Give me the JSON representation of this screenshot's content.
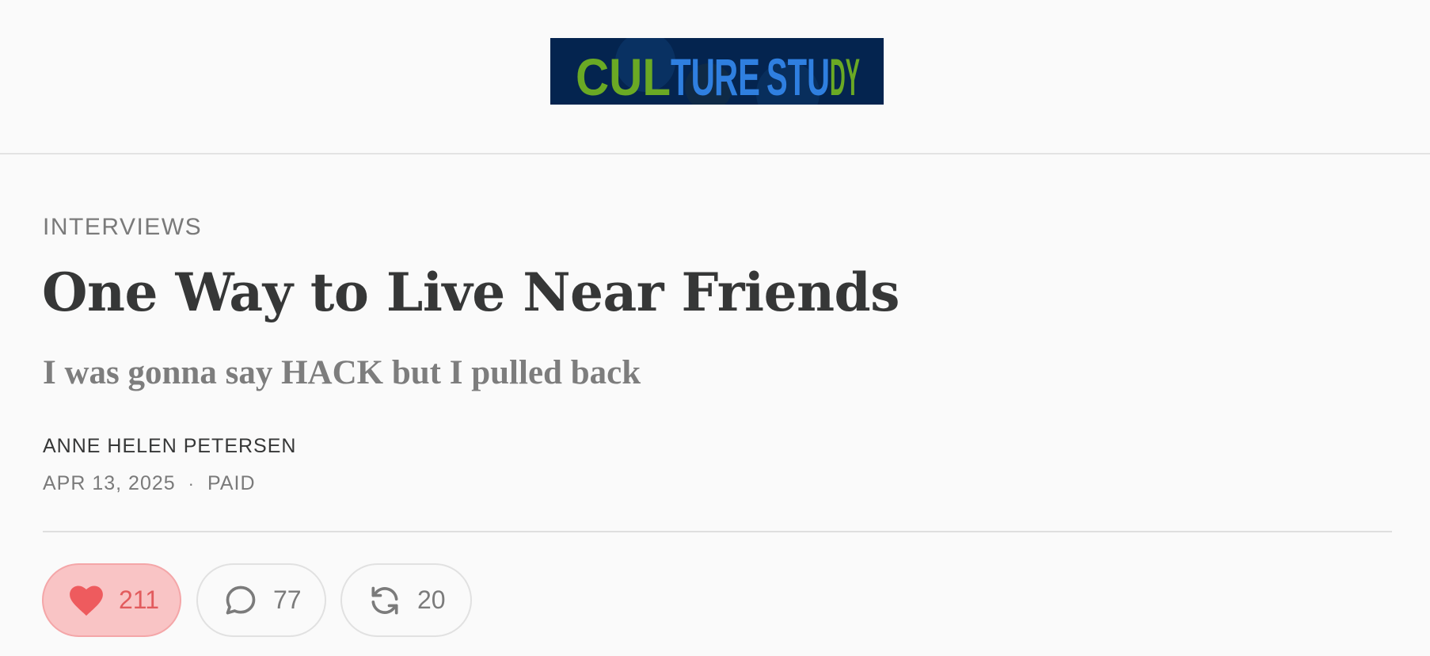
{
  "header": {
    "logo_text": "CULTURE STUDY",
    "logo_colors": {
      "background": "#04244f",
      "green": "#6aa924",
      "blue": "#2f7fe0"
    }
  },
  "article": {
    "section": "INTERVIEWS",
    "title": "One Way to Live Near Friends",
    "subtitle": "I was gonna say HACK but I pulled back",
    "author": "ANNE HELEN PETERSEN",
    "date": "APR 13, 2025",
    "separator": "·",
    "access": "PAID"
  },
  "actions": {
    "likes": {
      "count": "211",
      "icon": "heart-icon",
      "active": true,
      "color": "#e25b5d"
    },
    "comments": {
      "count": "77",
      "icon": "comment-bubble-icon"
    },
    "restacks": {
      "count": "20",
      "icon": "restack-icon"
    }
  }
}
